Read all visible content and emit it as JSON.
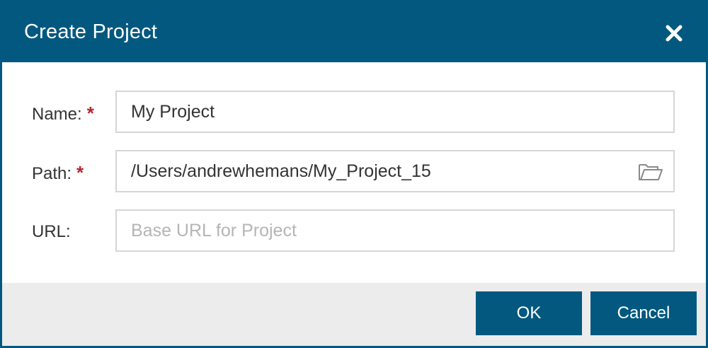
{
  "dialog": {
    "title": "Create Project",
    "close_icon": "close-icon"
  },
  "form": {
    "name": {
      "label": "Name:",
      "required_mark": "*",
      "value": "My Project",
      "placeholder": ""
    },
    "path": {
      "label": "Path:",
      "required_mark": "*",
      "value": "/Users/andrewhemans/My_Project_15",
      "placeholder": "",
      "browse_icon": "folder-open-icon"
    },
    "url": {
      "label": "URL:",
      "value": "",
      "placeholder": "Base URL for Project"
    }
  },
  "footer": {
    "ok_label": "OK",
    "cancel_label": "Cancel"
  },
  "colors": {
    "primary": "#02587f",
    "required": "#b3282d",
    "footer_bg": "#ececec",
    "field_border": "#d6d6d6"
  }
}
